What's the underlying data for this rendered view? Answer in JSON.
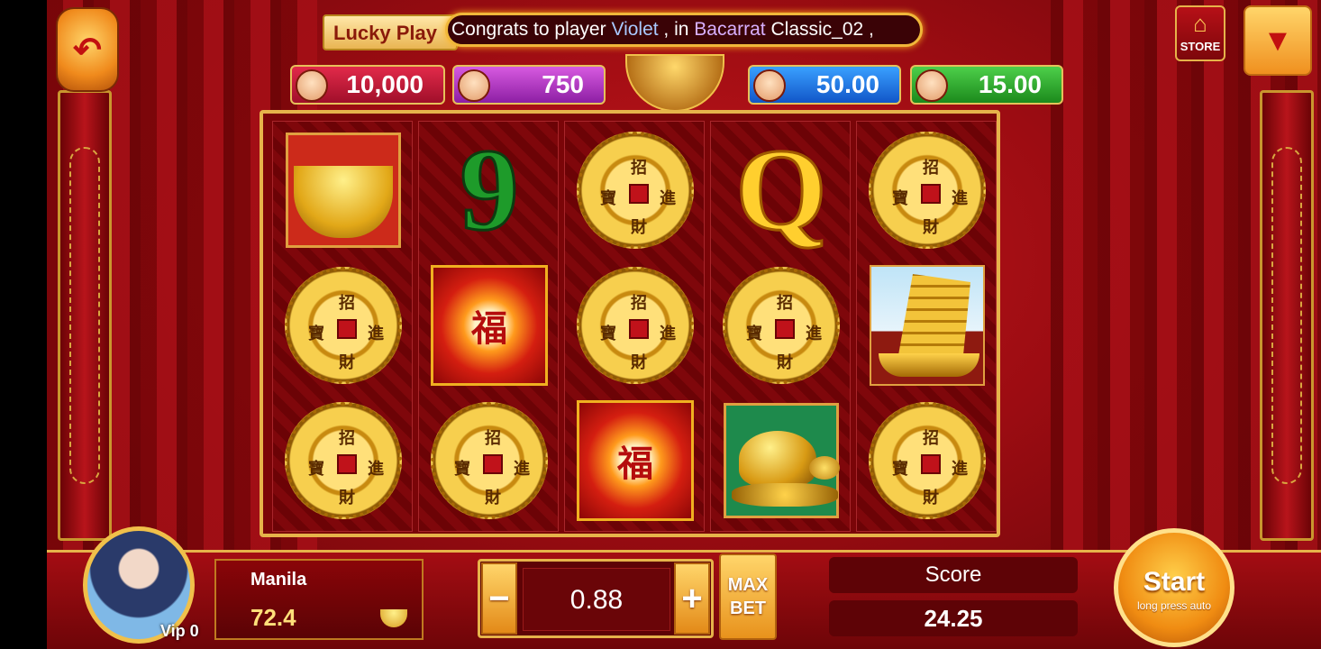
{
  "ticker": {
    "tab_label": "Lucky Play",
    "msg_prefix": "Congrats to player ",
    "player": "Violet",
    "sep": " ,  in ",
    "game": "Bacarrat",
    "msg_suffix": " Classic_02 ,"
  },
  "top_buttons": {
    "store_label": "STORE"
  },
  "jackpots": [
    "10,000",
    "750",
    "50.00",
    "15.00"
  ],
  "reels": [
    [
      "ingot",
      "nine",
      "coin",
      "queen",
      "coin"
    ],
    [
      "coin",
      "fu",
      "coin",
      "coin",
      "ship"
    ],
    [
      "coin",
      "coin",
      "fu",
      "turtle",
      "coin"
    ]
  ],
  "symbols": {
    "nine_text": "9",
    "queen_text": "Q",
    "fu_text": "福",
    "coin_chars": [
      "招",
      "財",
      "寶",
      "進"
    ]
  },
  "player": {
    "name": "Manila",
    "balance": "72.4",
    "vip": "Vip 0"
  },
  "bet": {
    "minus": "−",
    "plus": "+",
    "value": "0.88",
    "max_bet": "MAX BET"
  },
  "score": {
    "label": "Score",
    "value": "24.25"
  },
  "start": {
    "label": "Start",
    "sub": "long press auto"
  }
}
